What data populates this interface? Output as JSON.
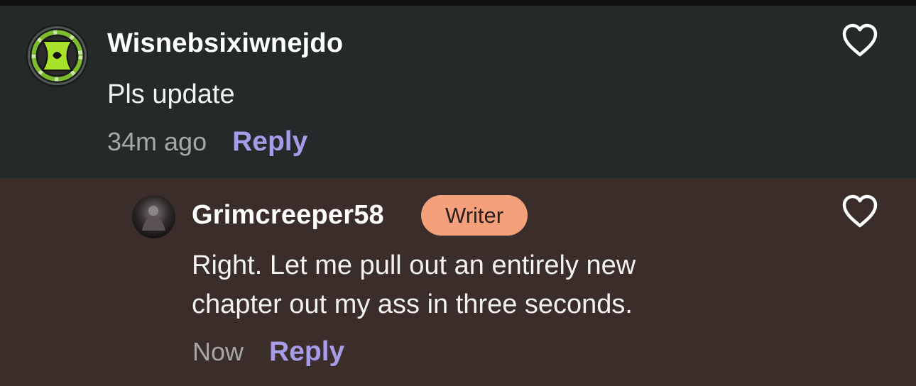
{
  "comment": {
    "username": "Wisnebsixiwnejdo",
    "text": "Pls update",
    "time": "34m ago",
    "reply_label": "Reply",
    "avatar_icon": "omnitrix-icon",
    "like_icon": "heart-outline-icon"
  },
  "reply": {
    "username": "Grimcreeper58",
    "badge": "Writer",
    "text_line1": "Right. Let me pull out an entirely new",
    "text_line2": "chapter out my ass in three seconds.",
    "time": "Now",
    "reply_label": "Reply",
    "like_icon": "heart-outline-icon"
  },
  "colors": {
    "comment_bg": "#232a29",
    "reply_bg": "#3a2d2a",
    "accent": "#a89ce8",
    "badge_bg": "#f4a07b"
  }
}
